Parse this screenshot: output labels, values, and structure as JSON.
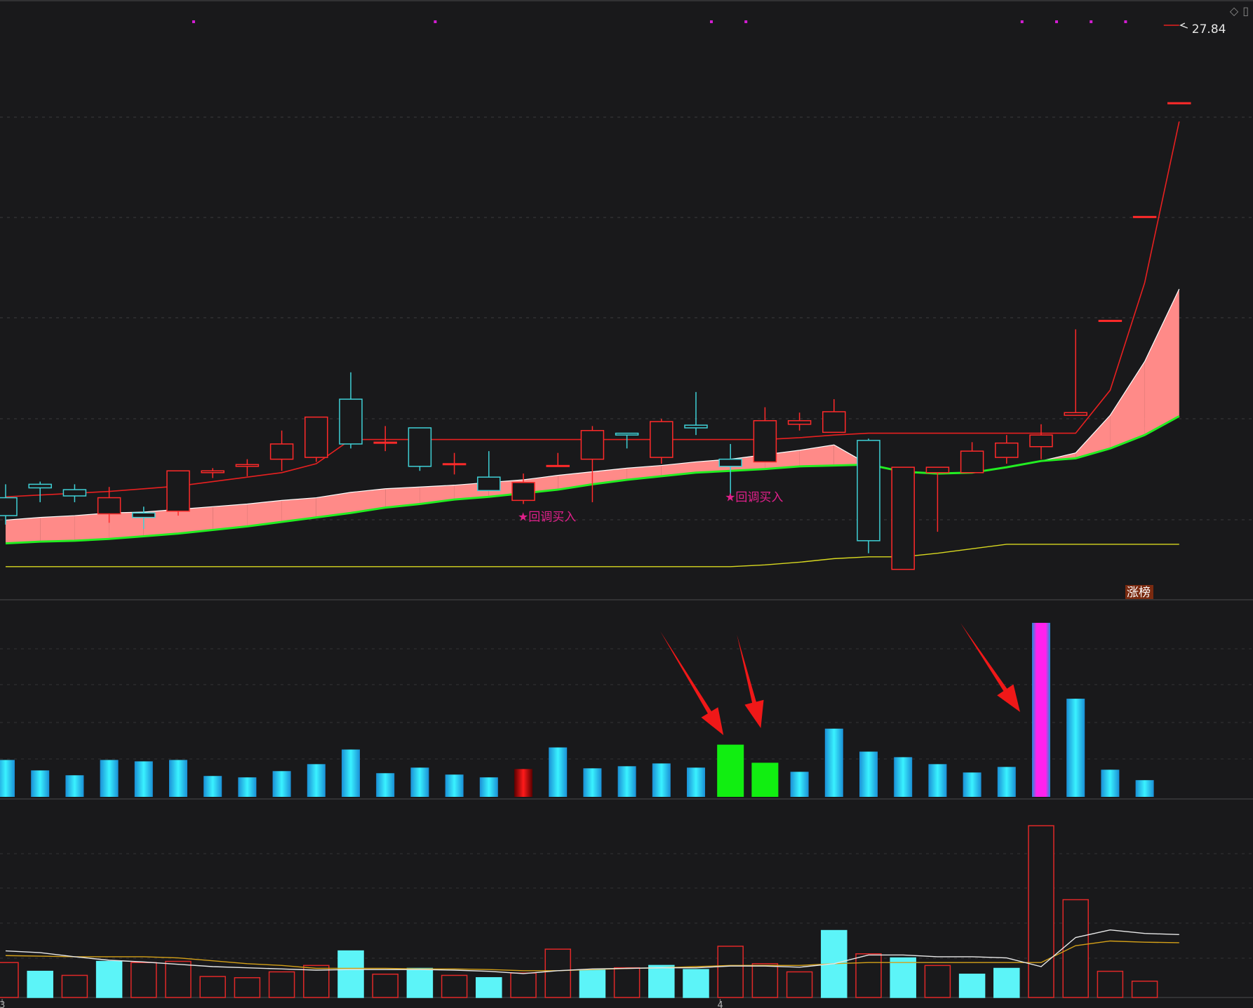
{
  "chart_data": [
    {
      "type": "candlestick",
      "panel": "price",
      "bars": [
        {
          "open": 9.6,
          "close": 9.4,
          "high": 9.75,
          "low": 9.3
        },
        {
          "open": 9.75,
          "close": 9.71,
          "high": 9.78,
          "low": 9.55
        },
        {
          "open": 9.69,
          "close": 9.62,
          "high": 9.75,
          "low": 9.55
        },
        {
          "open": 9.42,
          "close": 9.6,
          "high": 9.72,
          "low": 9.32
        },
        {
          "open": 9.43,
          "close": 9.38,
          "high": 9.5,
          "low": 9.25
        },
        {
          "open": 9.45,
          "close": 9.9,
          "high": 9.9,
          "low": 9.4
        },
        {
          "open": 9.88,
          "close": 9.9,
          "high": 9.93,
          "low": 9.82
        },
        {
          "open": 9.95,
          "close": 9.97,
          "high": 10.03,
          "low": 9.84
        },
        {
          "open": 10.03,
          "close": 10.2,
          "high": 10.35,
          "low": 9.9
        },
        {
          "open": 10.05,
          "close": 10.5,
          "high": 10.5,
          "low": 10.0
        },
        {
          "open": 10.7,
          "close": 10.2,
          "high": 11.0,
          "low": 10.15
        },
        {
          "open": 10.22,
          "close": 10.22,
          "high": 10.4,
          "low": 10.12
        },
        {
          "open": 10.38,
          "close": 9.95,
          "high": 10.38,
          "low": 9.9
        },
        {
          "open": 9.98,
          "close": 9.98,
          "high": 10.1,
          "low": 9.86
        },
        {
          "open": 9.83,
          "close": 9.68,
          "high": 10.12,
          "low": 9.68
        },
        {
          "open": 9.57,
          "close": 9.77,
          "high": 9.87,
          "low": 9.53
        },
        {
          "open": 9.95,
          "close": 9.96,
          "high": 10.1,
          "low": 9.96
        },
        {
          "open": 10.03,
          "close": 10.35,
          "high": 10.4,
          "low": 9.55
        },
        {
          "open": 10.32,
          "close": 10.3,
          "high": 10.32,
          "low": 10.15
        },
        {
          "open": 10.05,
          "close": 10.45,
          "high": 10.48,
          "low": 9.98
        },
        {
          "open": 10.41,
          "close": 10.38,
          "high": 10.78,
          "low": 10.3
        },
        {
          "open": 10.03,
          "close": 9.95,
          "high": 10.2,
          "low": 9.64
        },
        {
          "open": 10.0,
          "close": 10.46,
          "high": 10.61,
          "low": 10.0
        },
        {
          "open": 10.42,
          "close": 10.46,
          "high": 10.55,
          "low": 10.35
        },
        {
          "open": 10.33,
          "close": 10.56,
          "high": 10.7,
          "low": 10.33
        },
        {
          "open": 10.24,
          "close": 9.12,
          "high": 10.26,
          "low": 8.98
        },
        {
          "open": 8.8,
          "close": 9.94,
          "high": 9.94,
          "low": 8.8
        },
        {
          "open": 9.88,
          "close": 9.94,
          "high": 9.94,
          "low": 9.22
        },
        {
          "open": 9.88,
          "close": 10.12,
          "high": 10.22,
          "low": 9.88
        },
        {
          "open": 10.05,
          "close": 10.21,
          "high": 10.3,
          "low": 9.98
        },
        {
          "open": 10.17,
          "close": 10.3,
          "high": 10.42,
          "low": 10.03
        },
        {
          "open": 10.52,
          "close": 10.55,
          "high": 11.48,
          "low": 10.52
        },
        {
          "open": 11.58,
          "close": 11.58,
          "high": 11.58,
          "low": 11.58
        },
        {
          "open": 12.74,
          "close": 12.74,
          "high": 12.74,
          "low": 12.74
        },
        {
          "open": 14.01,
          "close": 14.01,
          "high": 14.01,
          "low": 14.01
        }
      ],
      "ma_red": [
        9.61,
        9.63,
        9.65,
        9.67,
        9.7,
        9.73,
        9.78,
        9.83,
        9.88,
        9.98,
        10.25,
        10.25,
        10.25,
        10.25,
        10.25,
        10.25,
        10.25,
        10.25,
        10.25,
        10.25,
        10.25,
        10.25,
        10.25,
        10.27,
        10.3,
        10.32,
        10.32,
        10.32,
        10.32,
        10.32,
        10.32,
        10.32,
        10.8,
        12.0,
        13.8
      ],
      "band_upper": [
        9.35,
        9.38,
        9.4,
        9.43,
        9.44,
        9.47,
        9.5,
        9.53,
        9.57,
        9.6,
        9.66,
        9.7,
        9.72,
        9.74,
        9.77,
        9.8,
        9.85,
        9.89,
        9.93,
        9.96,
        10.0,
        10.03,
        10.08,
        10.13,
        10.19,
        9.97,
        9.89,
        9.87,
        9.88,
        9.94,
        10.01,
        10.1,
        10.52,
        11.12,
        11.93
      ],
      "band_lower": [
        9.09,
        9.11,
        9.12,
        9.14,
        9.17,
        9.2,
        9.24,
        9.28,
        9.33,
        9.38,
        9.43,
        9.49,
        9.53,
        9.58,
        9.61,
        9.65,
        9.69,
        9.75,
        9.8,
        9.84,
        9.88,
        9.9,
        9.92,
        9.95,
        9.96,
        9.97,
        9.89,
        9.87,
        9.88,
        9.94,
        10.01,
        10.04,
        10.15,
        10.3,
        10.51
      ],
      "ma_yellow": [
        8.83,
        8.83,
        8.83,
        8.83,
        8.83,
        8.83,
        8.83,
        8.83,
        8.83,
        8.83,
        8.83,
        8.83,
        8.83,
        8.83,
        8.83,
        8.83,
        8.83,
        8.83,
        8.83,
        8.83,
        8.83,
        8.83,
        8.85,
        8.88,
        8.92,
        8.94,
        8.94,
        8.98,
        9.03,
        9.08,
        9.08,
        9.08,
        9.08,
        9.08,
        9.08
      ],
      "signals": [
        {
          "bar": 15,
          "text": "★回调买入",
          "price": 9.34
        },
        {
          "bar": 21,
          "text": "★回调买入",
          "price": 9.56
        }
      ],
      "top_dots": [
        5,
        12,
        20,
        21,
        29,
        30,
        31,
        32
      ],
      "high_label": "27.84",
      "ylim": [
        8.5,
        15.0
      ],
      "colors": {
        "up": "#ff2a2a",
        "down": "#3fd0d6",
        "band_fill_up": "#ff8a88",
        "band_fill_down": "#22ee22",
        "ma_yellow": "#d8d820",
        "band_line": "#22ee22",
        "dot": "#d21dd2"
      }
    },
    {
      "type": "bar",
      "panel": "indicator",
      "values": [
        53,
        38,
        31,
        53,
        51,
        53,
        30,
        28,
        37,
        47,
        68,
        34,
        42,
        32,
        28,
        40,
        71,
        41,
        44,
        48,
        42,
        75,
        49,
        36,
        98,
        65,
        57,
        47,
        35,
        43,
        250,
        141,
        39,
        24
      ],
      "start_bar": 0,
      "special": [
        {
          "bar": 15,
          "color": "red"
        },
        {
          "bar": 21,
          "color": "green"
        },
        {
          "bar": 22,
          "color": "green"
        },
        {
          "bar": 30,
          "color": "magenta"
        }
      ],
      "badge": "涨榜",
      "arrows_at": [
        21,
        22,
        30
      ],
      "ylim": [
        0,
        260
      ]
    },
    {
      "type": "bar",
      "panel": "volume",
      "values": [
        60,
        45,
        38,
        62,
        60,
        62,
        36,
        34,
        44,
        55,
        80,
        40,
        50,
        38,
        34,
        42,
        83,
        47,
        51,
        55,
        48,
        88,
        58,
        44,
        115,
        75,
        68,
        55,
        40,
        50,
        295,
        168,
        45,
        28
      ],
      "bar_up": [
        true,
        false,
        true,
        false,
        true,
        true,
        true,
        true,
        true,
        true,
        false,
        true,
        false,
        true,
        false,
        true,
        true,
        false,
        true,
        false,
        false,
        true,
        true,
        true,
        false,
        true,
        false,
        true,
        false,
        false,
        true,
        true,
        true,
        true
      ],
      "ma_white": [
        80,
        77,
        70,
        64,
        61,
        57,
        53,
        51,
        49,
        47,
        48,
        48,
        48,
        47,
        45,
        41,
        46,
        49,
        50,
        51,
        51,
        54,
        54,
        52,
        58,
        73,
        73,
        70,
        70,
        68,
        53,
        103,
        116,
        110,
        108
      ],
      "ma_yellow": [
        72,
        71,
        70,
        70,
        70,
        68,
        63,
        58,
        55,
        50,
        50,
        50,
        49,
        49,
        48,
        46,
        46,
        48,
        50,
        51,
        53,
        55,
        55,
        55,
        58,
        60,
        60,
        60,
        60,
        60,
        60,
        89,
        97,
        95,
        94
      ],
      "ylim": [
        0,
        300
      ],
      "x_labels": [
        {
          "bar": -0.1,
          "text": "3"
        },
        {
          "bar": 20.7,
          "text": "4"
        }
      ]
    }
  ]
}
